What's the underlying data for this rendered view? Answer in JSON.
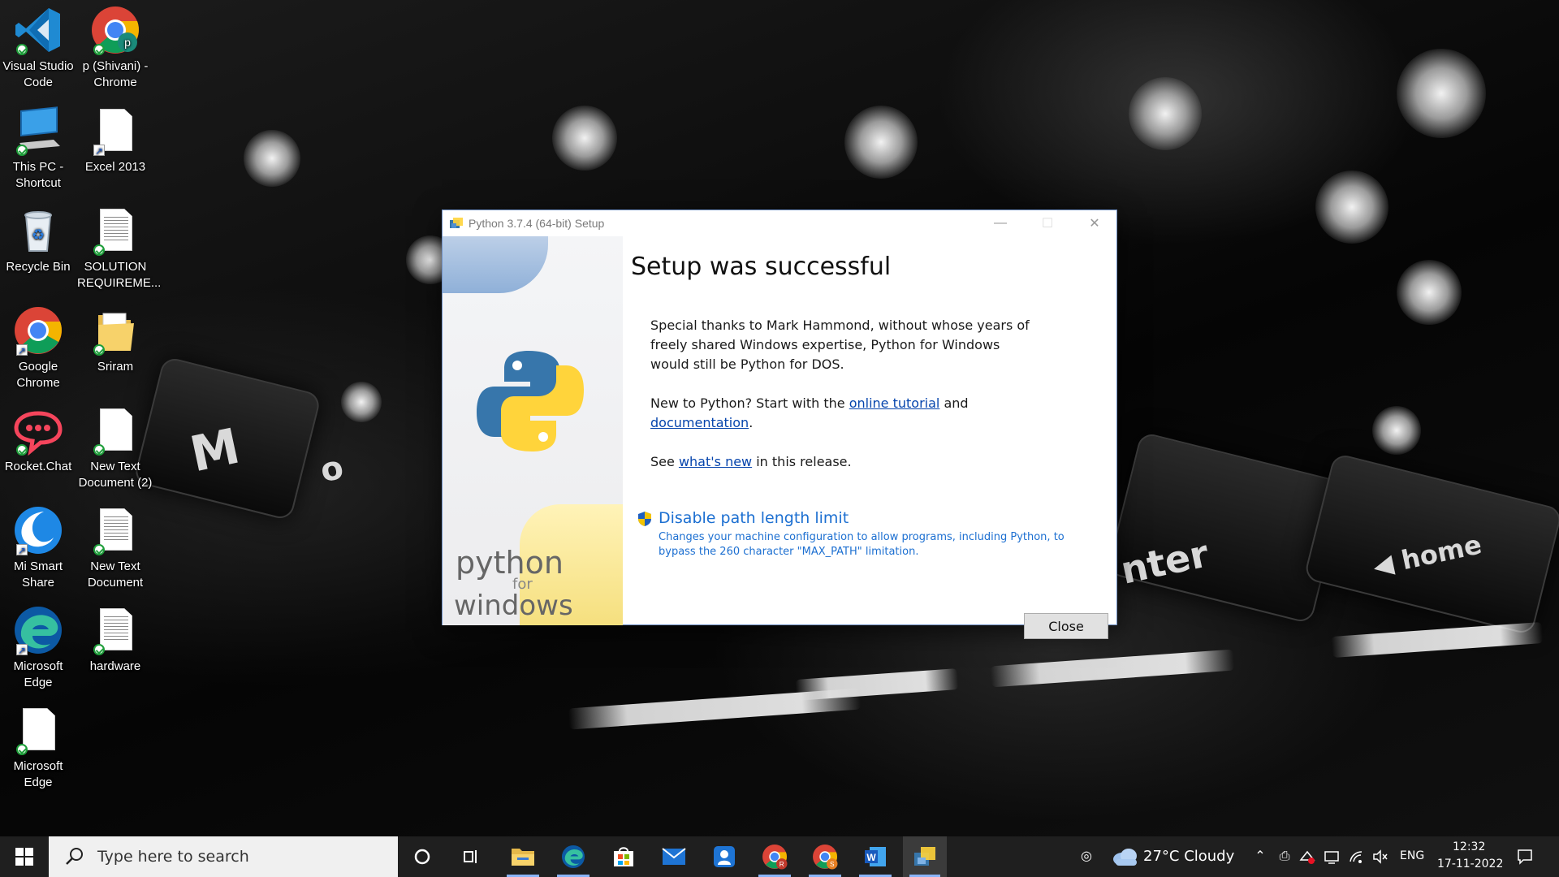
{
  "desktop": {
    "icons": [
      {
        "label": "Visual Studio Code",
        "icon": "vscode-icon"
      },
      {
        "label": "p (Shivani) - Chrome",
        "icon": "chrome-profile-icon"
      },
      {
        "label": "This PC - Shortcut",
        "icon": "this-pc-icon"
      },
      {
        "label": "Excel 2013",
        "icon": "document-icon"
      },
      {
        "label": "Recycle Bin",
        "icon": "recycle-bin-icon"
      },
      {
        "label": "SOLUTION REQUIREME...",
        "icon": "document-icon"
      },
      {
        "label": "Google Chrome",
        "icon": "chrome-icon"
      },
      {
        "label": "Sriram",
        "icon": "folder-icon"
      },
      {
        "label": "Rocket.Chat",
        "icon": "rocketchat-icon"
      },
      {
        "label": "New Text Document (2)",
        "icon": "text-document-icon"
      },
      {
        "label": "Mi Smart Share",
        "icon": "mi-smart-share-icon"
      },
      {
        "label": "New Text Document",
        "icon": "text-document-icon"
      },
      {
        "label": "Microsoft Edge",
        "icon": "edge-icon"
      },
      {
        "label": "hardware",
        "icon": "text-document-icon"
      },
      {
        "label": "Microsoft Edge",
        "icon": "document-icon"
      }
    ]
  },
  "wallpaper": {
    "key_letters": [
      "M",
      "o",
      "nter",
      "◀ home"
    ]
  },
  "dialog": {
    "title": "Python 3.7.4 (64-bit) Setup",
    "heading": "Setup was successful",
    "thanks": "Special thanks to Mark Hammond, without whose years of freely shared Windows expertise, Python for Windows would still be Python for DOS.",
    "new_to_python_prefix": "New to Python? Start with the ",
    "online_tutorial": "online tutorial",
    "and": " and ",
    "documentation": "documentation",
    "period": ".",
    "see_prefix": "See ",
    "whats_new": "what's new",
    "see_suffix": " in this release.",
    "disable_path": "Disable path length limit",
    "disable_path_desc": "Changes your machine configuration to allow programs, including Python, to bypass the 260 character \"MAX_PATH\" limitation.",
    "close_label": "Close",
    "side": {
      "python": "python",
      "for": "for",
      "windows": "windows"
    },
    "controls": {
      "minimize": "—",
      "maximize": "☐",
      "close": "✕"
    }
  },
  "taskbar": {
    "search_placeholder": "Type here to search",
    "apps": [
      "cortana-circle-icon",
      "task-view-icon",
      "file-explorer-icon",
      "edge-icon",
      "microsoft-store-icon",
      "mail-icon",
      "people-icon",
      "chrome-profile-r-icon",
      "chrome-profile-s-icon",
      "word-icon",
      "python-setup-icon"
    ],
    "weather": "27°C  Cloudy",
    "language": "ENG",
    "time": "12:32",
    "date": "17-11-2022"
  },
  "colors": {
    "link": "#0645ad",
    "accent_link": "#1c6fd1",
    "taskbar": "#1f1f1f",
    "python_blue": "#3776ab",
    "python_yellow": "#ffd43b"
  }
}
